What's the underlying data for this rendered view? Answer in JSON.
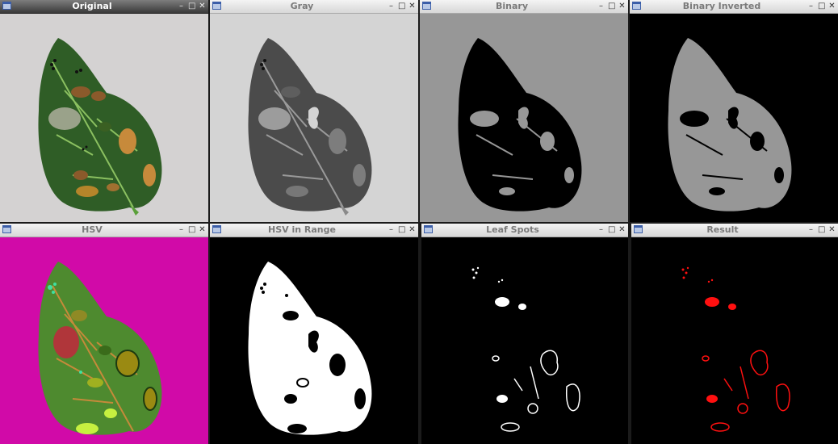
{
  "windows": [
    {
      "title": "Original",
      "bg": "#d4d2d2",
      "active": true
    },
    {
      "title": "Gray",
      "bg": "#d4d4d4",
      "active": false
    },
    {
      "title": "Binary",
      "bg": "#979797",
      "active": false
    },
    {
      "title": "Binary Inverted",
      "bg": "#000000",
      "active": false
    },
    {
      "title": "HSV",
      "bg": "#d10aa8",
      "active": false
    },
    {
      "title": "HSV in Range",
      "bg": "#000000",
      "active": false
    },
    {
      "title": "Leaf Spots",
      "bg": "#000000",
      "active": false
    },
    {
      "title": "Result",
      "bg": "#000000",
      "active": false
    }
  ],
  "controls": {
    "minimize": "–",
    "maximize": "□",
    "close": "✕"
  }
}
